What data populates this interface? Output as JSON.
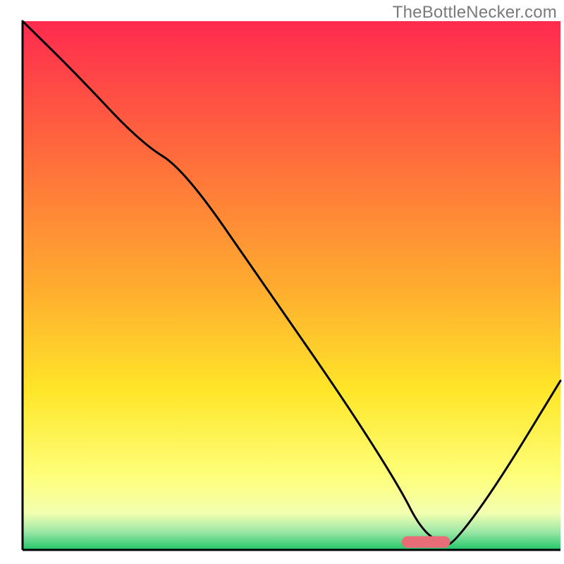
{
  "watermark": "TheBottleNecker.com",
  "chart_data": {
    "type": "line",
    "title": "",
    "xlabel": "",
    "ylabel": "",
    "xlim": [
      0,
      100
    ],
    "ylim": [
      0,
      100
    ],
    "grid": false,
    "gradient_note": "background is a smooth vertical color ramp: red (top) → orange → yellow → pale-yellow → green (bottom narrow band)",
    "gradient_stops": [
      {
        "offset": 0.0,
        "color": "#ff2a4f"
      },
      {
        "offset": 0.25,
        "color": "#ff6b3c"
      },
      {
        "offset": 0.5,
        "color": "#ffab2f"
      },
      {
        "offset": 0.7,
        "color": "#ffe629"
      },
      {
        "offset": 0.86,
        "color": "#feff7a"
      },
      {
        "offset": 0.93,
        "color": "#f3ffb0"
      },
      {
        "offset": 0.965,
        "color": "#9fe8a7"
      },
      {
        "offset": 1.0,
        "color": "#22c66a"
      }
    ],
    "series": [
      {
        "name": "bottleneck-curve",
        "color": "#000000",
        "x": [
          0,
          10,
          22,
          30,
          45,
          60,
          70,
          74,
          78,
          80,
          88,
          100
        ],
        "y": [
          100,
          90,
          77,
          72,
          50,
          28,
          12,
          4,
          1,
          1,
          12,
          32
        ]
      }
    ],
    "markers": [
      {
        "name": "optimal-marker",
        "shape": "rounded-bar",
        "color": "#e96d78",
        "x_center": 75,
        "y": 1.5,
        "width_pct": 9,
        "height_pct": 2.2
      }
    ],
    "plot_frame": {
      "stroke": "#000000",
      "stroke_width": 3,
      "sides": [
        "left",
        "bottom"
      ]
    }
  }
}
